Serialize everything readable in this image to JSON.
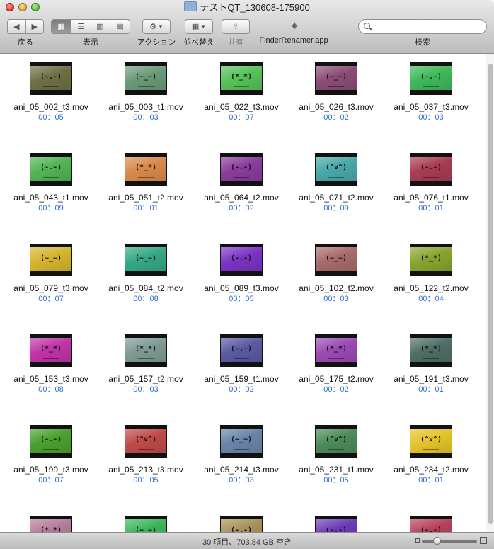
{
  "window": {
    "title": "テストQT_130608-175900"
  },
  "toolbar": {
    "back_label": "戻る",
    "view_label": "表示",
    "action_label": "アクション",
    "arrange_label": "並べ替え",
    "share_label": "共有",
    "app_label": "FinderRenamer.app",
    "search_label": "検索",
    "search_placeholder": ""
  },
  "files": [
    {
      "name": "ani_05_002_t3.mov",
      "duration": "00：05",
      "face": "(-.-)",
      "color": "#6f6f45"
    },
    {
      "name": "ani_05_003_t1.mov",
      "duration": "00：03",
      "face": "(~_~)",
      "color": "#6a9a79"
    },
    {
      "name": "ani_05_022_t3.mov",
      "duration": "00：07",
      "face": "(*_*)",
      "color": "#57c25a"
    },
    {
      "name": "ani_05_026_t3.mov",
      "duration": "00：02",
      "face": "(~_~)",
      "color": "#8a4d76"
    },
    {
      "name": "ani_05_037_t3.mov",
      "duration": "00：03",
      "face": "(-.-)",
      "color": "#3fb85a"
    },
    {
      "name": "ani_05_043_t1.mov",
      "duration": "00：09",
      "face": "(-.-)",
      "color": "#52b454"
    },
    {
      "name": "ani_05_051_t2.mov",
      "duration": "00：01",
      "face": "(*_*)",
      "color": "#d88a4c"
    },
    {
      "name": "ani_05_064_t2.mov",
      "duration": "00：02",
      "face": "(-.-)",
      "color": "#8a3d9c"
    },
    {
      "name": "ani_05_071_t2.mov",
      "duration": "00：09",
      "face": "(^v^)",
      "color": "#4aa8a8"
    },
    {
      "name": "ani_05_076_t1.mov",
      "duration": "00：01",
      "face": "(-.-)",
      "color": "#a83d52"
    },
    {
      "name": "ani_05_079_t3.mov",
      "duration": "00：07",
      "face": "(~_~)",
      "color": "#d4b42e"
    },
    {
      "name": "ani_05_084_t2.mov",
      "duration": "00：08",
      "face": "(~_~)",
      "color": "#33a884"
    },
    {
      "name": "ani_05_089_t3.mov",
      "duration": "00：05",
      "face": "(-.-)",
      "color": "#7b33c4"
    },
    {
      "name": "ani_05_102_t2.mov",
      "duration": "00：03",
      "face": "(~_~)",
      "color": "#a86a6a"
    },
    {
      "name": "ani_05_122_t2.mov",
      "duration": "00：04",
      "face": "(*_*)",
      "color": "#88a42e"
    },
    {
      "name": "ani_05_153_t3.mov",
      "duration": "00：08",
      "face": "(*_*)",
      "color": "#c033a8"
    },
    {
      "name": "ani_05_157_t2.mov",
      "duration": "00：03",
      "face": "(*_*)",
      "color": "#7f9a94"
    },
    {
      "name": "ani_05_159_t1.mov",
      "duration": "00：02",
      "face": "(-.-)",
      "color": "#5a5aa0"
    },
    {
      "name": "ani_05_175_t2.mov",
      "duration": "00：02",
      "face": "(*_*)",
      "color": "#9a4ab4"
    },
    {
      "name": "ani_05_191_t3.mov",
      "duration": "00：01",
      "face": "(*_*)",
      "color": "#4e6e66"
    },
    {
      "name": "ani_05_199_t3.mov",
      "duration": "00：07",
      "face": "(-.-)",
      "color": "#4aa02e"
    },
    {
      "name": "ani_05_213_t3.mov",
      "duration": "00：05",
      "face": "(^v^)",
      "color": "#c04a4a"
    },
    {
      "name": "ani_05_214_t3.mov",
      "duration": "00：03",
      "face": "(~_~)",
      "color": "#6a84a8"
    },
    {
      "name": "ani_05_231_t1.mov",
      "duration": "00：05",
      "face": "(^v^)",
      "color": "#4e8a5a"
    },
    {
      "name": "ani_05_234_t2.mov",
      "duration": "00：01",
      "face": "(^v^)",
      "color": "#e4c42a"
    },
    {
      "name": "",
      "duration": "",
      "face": "(*_*)",
      "color": "#b47a9a"
    },
    {
      "name": "",
      "duration": "",
      "face": "(~_~)",
      "color": "#3cb45a"
    },
    {
      "name": "",
      "duration": "",
      "face": "(-.-)",
      "color": "#a8905a"
    },
    {
      "name": "",
      "duration": "",
      "face": "(-.-)",
      "color": "#6a3ab4"
    },
    {
      "name": "",
      "duration": "",
      "face": "(-.-)",
      "color": "#b4405a"
    }
  ],
  "status": {
    "text": "30 項目、703.84 GB 空き"
  }
}
